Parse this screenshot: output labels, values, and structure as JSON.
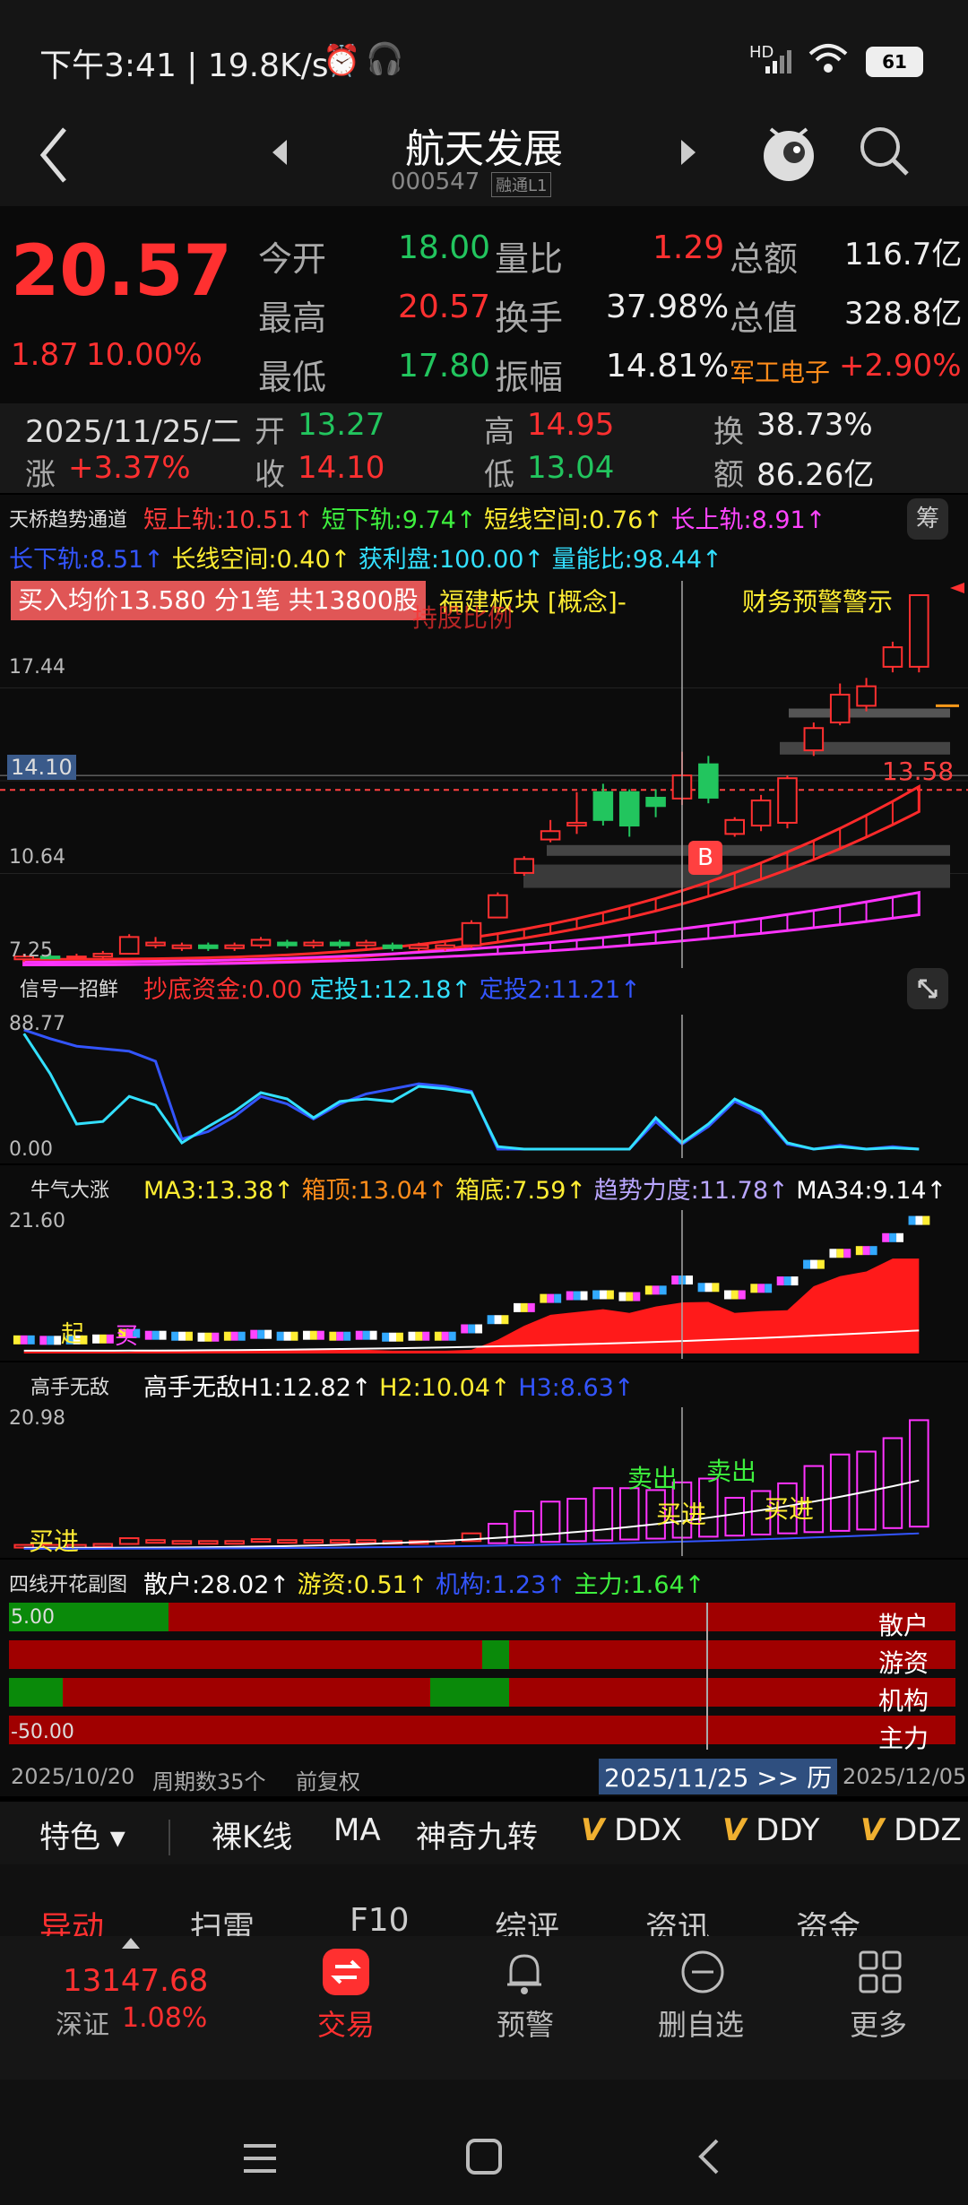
{
  "status": {
    "time_speed": "下午3:41 | 19.8K/s",
    "battery": "61",
    "hd": "HD"
  },
  "nav": {
    "title": "航天发展",
    "code": "000547",
    "tags": "融通L1"
  },
  "quote": {
    "price": "20.57",
    "change": "1.87",
    "change_pct": "10.00%",
    "rows": [
      {
        "l1": "今开",
        "v1": "18.00",
        "l2": "量比",
        "v2": "1.29",
        "l3": "总额",
        "v3": "116.7亿"
      },
      {
        "l1": "最高",
        "v1": "20.57",
        "l2": "换手",
        "v2": "37.98%",
        "l3": "总值",
        "v3": "328.8亿"
      },
      {
        "l1": "最低",
        "v1": "17.80",
        "l2": "振幅",
        "v2": "14.81%",
        "l3": "军工电子",
        "v3": "+2.90%"
      }
    ]
  },
  "hist": {
    "date": "2025/11/25/二",
    "open_l": "开",
    "open": "13.27",
    "high_l": "高",
    "high": "14.95",
    "turn_l": "换",
    "turn": "38.73%",
    "chg_l": "涨",
    "chg": "+3.37%",
    "close_l": "收",
    "close": "14.10",
    "low_l": "低",
    "low": "13.04",
    "amt_l": "额",
    "amt": "86.26亿"
  },
  "main_ind": {
    "name": "天桥趋势通道",
    "items": [
      {
        "t": "短上轨:10.51↑",
        "c": "#ff3b3b"
      },
      {
        "t": "短下轨:9.74↑",
        "c": "#3ef03e"
      },
      {
        "t": "短线空间:0.76↑",
        "c": "#ffee33"
      },
      {
        "t": "长上轨:8.91↑",
        "c": "#ff44ff"
      }
    ],
    "items2": [
      {
        "t": "长下轨:8.51↑",
        "c": "#3355ff"
      },
      {
        "t": "长线空间:0.40↑",
        "c": "#ffee33"
      },
      {
        "t": "获利盘:100.00↑",
        "c": "#33e0ff"
      },
      {
        "t": "量能比:98.44↑",
        "c": "#33e0ff"
      }
    ],
    "chip_btn": "筹",
    "buy_banner": "买入均价13.580 分1笔 共13800股",
    "concept": "福建板块 [概念]-",
    "warn": "财务预警警示",
    "y_top": "17.44",
    "y_cur": "14.10",
    "y_mid": "10.64",
    "y_low": "7.25",
    "price_tag": "13.58",
    "b_mark": "B",
    "hold_text": "持股比例"
  },
  "ind1": {
    "name": "信号一招鲜",
    "items": [
      {
        "t": "抄底资金:0.00",
        "c": "#ff3030"
      },
      {
        "t": "定投1:12.18↑",
        "c": "#33e0ff"
      },
      {
        "t": "定投2:11.21↑",
        "c": "#3355ff"
      }
    ],
    "y_top": "88.77",
    "y_bot": "0.00"
  },
  "ind2": {
    "name": "牛气大涨",
    "items": [
      {
        "t": "MA3:13.38↑",
        "c": "#ffee33"
      },
      {
        "t": "箱顶:13.04↑",
        "c": "#ff8c1a"
      },
      {
        "t": "箱底:7.59↑",
        "c": "#ffee33"
      },
      {
        "t": "趋势力度:11.78↑",
        "c": "#b9a6ff"
      },
      {
        "t": "MA34:9.14↑",
        "c": "#ffffff"
      }
    ],
    "y_top": "21.60",
    "start": "起",
    "buy": "买"
  },
  "ind3": {
    "name": "高手无敌",
    "items": [
      {
        "t": "高手无敌H1:12.82↑",
        "c": "#ffffff"
      },
      {
        "t": "H2:10.04↑",
        "c": "#ffee33"
      },
      {
        "t": "H3:8.63↑",
        "c": "#3355ff"
      }
    ],
    "y_top": "20.98",
    "buy": "买进",
    "sell": "卖出"
  },
  "ind4": {
    "name": "四线开花副图",
    "items": [
      {
        "t": "散户:28.02↑",
        "c": "#ffffff"
      },
      {
        "t": "游资:0.51↑",
        "c": "#ffee33"
      },
      {
        "t": "机构:1.23↑",
        "c": "#3355ff"
      },
      {
        "t": "主力:1.64↑",
        "c": "#3ef03e"
      }
    ],
    "labels": [
      "散户",
      "游资",
      "机构",
      "主力"
    ],
    "y_top": "5.00",
    "y_bot": "-50.00"
  },
  "axis": {
    "start": "2025/10/20",
    "period": "周期数35个",
    "adj": "前复权",
    "cursor": "2025/11/25 >> 历",
    "end": "2025/12/05"
  },
  "chart_tabs": [
    "特色",
    "裸K线",
    "MA",
    "神奇九转",
    "DDX",
    "DDY",
    "DDZ"
  ],
  "func_tabs": [
    "异动",
    "扫雷",
    "F10",
    "综评",
    "资讯",
    "资金"
  ],
  "bottom": {
    "index_val": "13147.68",
    "index_name": "深证",
    "index_pct": "1.08%",
    "trade": "交易",
    "alert": "预警",
    "remove": "删自选",
    "more": "更多"
  },
  "chart_data": {
    "type": "candlestick",
    "x_start": "2025/10/20",
    "x_end": "2025/12/05",
    "ylim": [
      7.25,
      20.57
    ],
    "candles": [
      {
        "o": 7.5,
        "c": 7.6,
        "h": 7.7,
        "l": 7.4
      },
      {
        "o": 7.6,
        "c": 7.55,
        "h": 7.7,
        "l": 7.5
      },
      {
        "o": 7.55,
        "c": 7.6,
        "h": 7.7,
        "l": 7.5
      },
      {
        "o": 7.6,
        "c": 7.7,
        "h": 7.8,
        "l": 7.5
      },
      {
        "o": 7.7,
        "c": 8.3,
        "h": 8.4,
        "l": 7.7
      },
      {
        "o": 8.0,
        "c": 8.1,
        "h": 8.3,
        "l": 7.9
      },
      {
        "o": 7.9,
        "c": 8.0,
        "h": 8.1,
        "l": 7.8
      },
      {
        "o": 8.0,
        "c": 7.9,
        "h": 8.1,
        "l": 7.8
      },
      {
        "o": 7.9,
        "c": 8.0,
        "h": 8.1,
        "l": 7.8
      },
      {
        "o": 8.0,
        "c": 8.2,
        "h": 8.3,
        "l": 7.9
      },
      {
        "o": 8.1,
        "c": 8.0,
        "h": 8.2,
        "l": 7.9
      },
      {
        "o": 8.0,
        "c": 8.1,
        "h": 8.2,
        "l": 7.9
      },
      {
        "o": 8.1,
        "c": 8.0,
        "h": 8.2,
        "l": 7.9
      },
      {
        "o": 8.0,
        "c": 8.1,
        "h": 8.2,
        "l": 7.9
      },
      {
        "o": 8.0,
        "c": 7.9,
        "h": 8.1,
        "l": 7.8
      },
      {
        "o": 7.9,
        "c": 8.0,
        "h": 8.1,
        "l": 7.8
      },
      {
        "o": 7.9,
        "c": 8.0,
        "h": 8.1,
        "l": 7.8
      },
      {
        "o": 8.0,
        "c": 8.8,
        "h": 8.9,
        "l": 7.9
      },
      {
        "o": 9.0,
        "c": 9.8,
        "h": 9.9,
        "l": 9.0
      },
      {
        "o": 10.6,
        "c": 11.1,
        "h": 11.2,
        "l": 10.5
      },
      {
        "o": 11.8,
        "c": 12.1,
        "h": 12.5,
        "l": 11.7
      },
      {
        "o": 12.3,
        "c": 12.4,
        "h": 13.5,
        "l": 12.0
      },
      {
        "o": 13.5,
        "c": 12.5,
        "h": 13.8,
        "l": 12.3
      },
      {
        "o": 13.5,
        "c": 12.3,
        "h": 13.6,
        "l": 11.9
      },
      {
        "o": 13.3,
        "c": 13.0,
        "h": 13.6,
        "l": 12.6
      },
      {
        "o": 13.27,
        "c": 14.1,
        "h": 14.95,
        "l": 13.04
      },
      {
        "o": 14.5,
        "c": 13.3,
        "h": 14.8,
        "l": 13.1
      },
      {
        "o": 12.0,
        "c": 12.5,
        "h": 12.6,
        "l": 11.9
      },
      {
        "o": 12.3,
        "c": 13.2,
        "h": 13.4,
        "l": 12.1
      },
      {
        "o": 12.4,
        "c": 14.0,
        "h": 14.1,
        "l": 12.2
      },
      {
        "o": 15.0,
        "c": 15.8,
        "h": 16.0,
        "l": 14.8
      },
      {
        "o": 16.0,
        "c": 17.0,
        "h": 17.4,
        "l": 15.9
      },
      {
        "o": 16.6,
        "c": 17.3,
        "h": 17.6,
        "l": 16.4
      },
      {
        "o": 18.0,
        "c": 18.7,
        "h": 18.9,
        "l": 17.8
      },
      {
        "o": 18.0,
        "c": 20.57,
        "h": 20.57,
        "l": 17.8
      }
    ]
  }
}
